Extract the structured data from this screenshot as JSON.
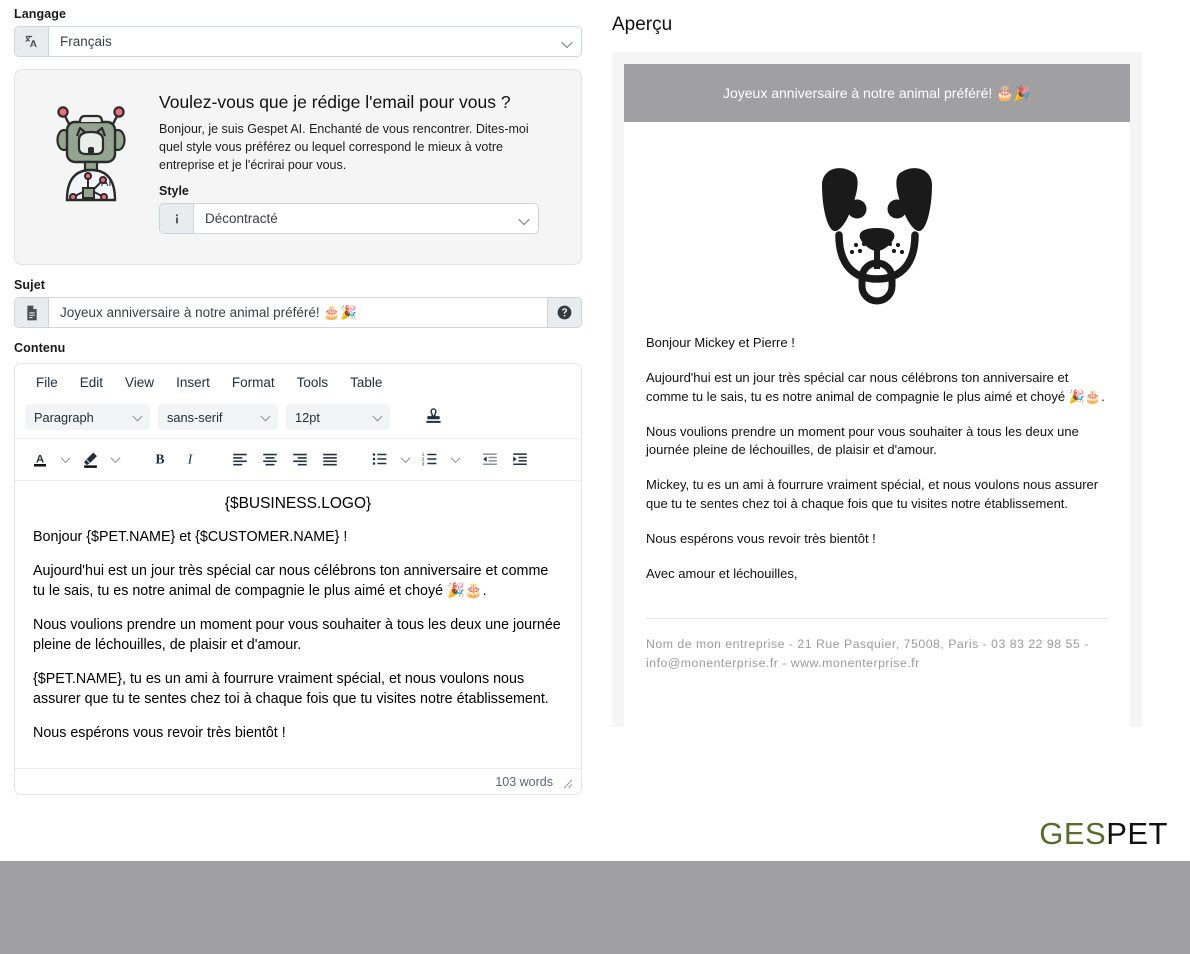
{
  "language_field": {
    "label": "Langage",
    "icon": "translate-icon",
    "value": "Français"
  },
  "ai_card": {
    "robot_icon": "ai-pet-robot-icon",
    "robot_badge": "AI",
    "title": "Voulez-vous que je rédige l'email pour vous ?",
    "description": "Bonjour, je suis Gespet AI. Enchanté de vous rencontrer. Dites-moi quel style vous préférez ou lequel correspond le mieux à votre entreprise et je l'écrirai pour vous.",
    "style_label": "Style",
    "style_icon": "info-icon",
    "style_value": "Décontracté"
  },
  "subject_field": {
    "label": "Sujet",
    "icon": "document-icon",
    "value": "Joyeux anniversaire à notre animal préféré! 🎂🎉",
    "help_icon": "help-circle-icon"
  },
  "content_field": {
    "label": "Contenu",
    "menubar": [
      "File",
      "Edit",
      "View",
      "Insert",
      "Format",
      "Tools",
      "Table"
    ],
    "toolbar_selects": {
      "block": "Paragraph",
      "font": "sans-serif",
      "size": "12pt"
    },
    "toolbar_icons": [
      "stamp-icon",
      "text-color-icon",
      "text-color-chevron-icon",
      "background-color-icon",
      "background-color-chevron-icon",
      "bold-icon",
      "italic-icon",
      "align-left-icon",
      "align-center-icon",
      "align-right-icon",
      "align-justify-icon",
      "bullet-list-icon",
      "bullet-list-chevron-icon",
      "numbered-list-icon",
      "numbered-list-chevron-icon",
      "outdent-icon",
      "indent-icon"
    ],
    "body": {
      "logo_placeholder": "{$BUSINESS.LOGO}",
      "paragraphs": [
        "Bonjour {$PET.NAME} et {$CUSTOMER.NAME} !",
        "Aujourd'hui est un jour très spécial car nous célébrons ton anniversaire et comme tu le sais, tu es notre animal de compagnie le plus aimé et choyé 🎉🎂.",
        "Nous voulions prendre un moment pour vous souhaiter à tous les deux une journée pleine de léchouilles, de plaisir et d'amour.",
        "{$PET.NAME}, tu es un ami à fourrure vraiment spécial, et nous voulons nous assurer que tu te sentes chez toi à chaque fois que tu visites notre établissement.",
        "Nous espérons vous revoir très bientôt !"
      ]
    },
    "word_count": "103 words",
    "resize_handle": "resize-grip-icon"
  },
  "preview": {
    "title": "Aperçu",
    "header_text": "Joyeux anniversaire à notre animal préféré! 🎂🎉",
    "header_bg": "#a0a0a3",
    "logo_icon": "dog-face-logo-icon",
    "paragraphs": [
      "Bonjour Mickey et Pierre !",
      "Aujourd'hui est un jour très spécial car nous célébrons ton anniversaire et comme tu le sais, tu es notre animal de compagnie le plus aimé et choyé 🎉🎂.",
      "Nous voulions prendre un moment pour vous souhaiter à tous les deux une journée pleine de léchouilles, de plaisir et d'amour.",
      "Mickey, tu es un ami à fourrure vraiment spécial, et nous voulons nous assurer que tu te sentes chez toi à chaque fois que tu visites notre établissement.",
      "Nous espérons vous revoir très bientôt !",
      "Avec amour et léchouilles,"
    ],
    "footer": "Nom de mon entreprise - 21 Rue Pasquier, 75008, Paris - 03 83 22 98 55 - info@monenterprise.fr - www.monenterprise.fr"
  },
  "brand": {
    "logo_part1": "GES",
    "logo_part2": "PET",
    "color_part1": "#5b6b2b",
    "color_part2": "#111111"
  }
}
